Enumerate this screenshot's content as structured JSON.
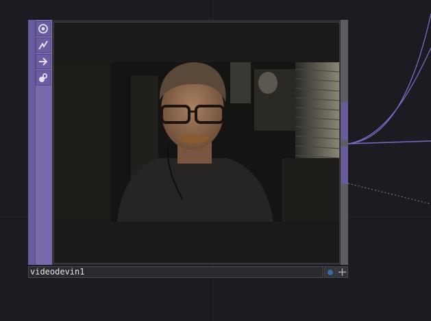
{
  "node": {
    "name": "videodevin1",
    "colors": {
      "sidebar": "#6a5b9c",
      "frame": "#2e2e35",
      "wire": "#7c6cc8",
      "background": "#1b1c21"
    }
  },
  "flags": [
    {
      "icon": "viewer-target-icon"
    },
    {
      "icon": "bypass-lightning-icon"
    },
    {
      "icon": "export-arrow-icon"
    },
    {
      "icon": "lock-icon"
    }
  ],
  "footer": {
    "left_icon": "blue-dot-icon",
    "right_icon": "crosshair-icon"
  }
}
